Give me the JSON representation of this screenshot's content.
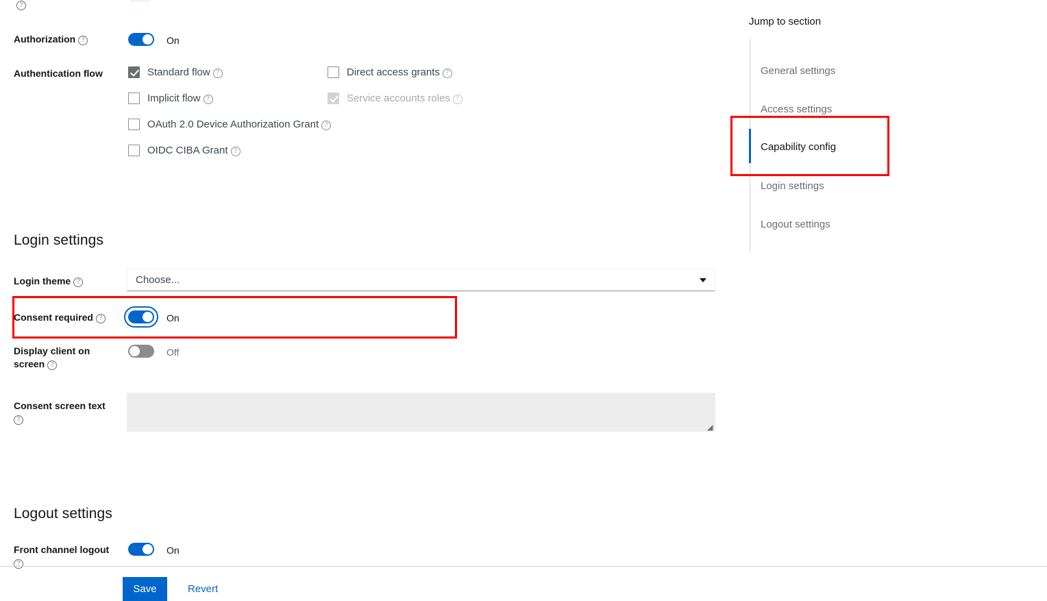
{
  "capability_config": {
    "authorization": {
      "label": "Authorization",
      "help": "?",
      "state": "On",
      "enabled": true
    },
    "authentication_flow": {
      "label": "Authentication flow",
      "options": [
        {
          "label": "Standard flow",
          "checked": true,
          "disabled": false,
          "help": "?"
        },
        {
          "label": "Direct access grants",
          "checked": false,
          "disabled": false,
          "help": "?"
        },
        {
          "label": "Implicit flow",
          "checked": false,
          "disabled": false,
          "help": "?"
        },
        {
          "label": "Service accounts roles",
          "checked": true,
          "disabled": true,
          "help": "?"
        },
        {
          "label": "OAuth 2.0 Device Authorization Grant",
          "checked": false,
          "disabled": false,
          "help": "?"
        },
        {
          "label": "OIDC CIBA Grant",
          "checked": false,
          "disabled": false,
          "help": "?"
        }
      ]
    }
  },
  "login_settings": {
    "heading": "Login settings",
    "login_theme": {
      "label": "Login theme",
      "help": "?",
      "value": "Choose...",
      "caret": "chevron-down-icon"
    },
    "consent_required": {
      "label": "Consent required",
      "help": "?",
      "state": "On",
      "enabled": true,
      "focused": true,
      "highlighted": true
    },
    "display_client_on_screen": {
      "label_line1": "Display client on",
      "label_line2": "screen",
      "help": "?",
      "state": "Off",
      "enabled": false
    },
    "consent_screen_text": {
      "label": "Consent screen text",
      "help": "?",
      "value": "",
      "disabled": true
    }
  },
  "logout_settings": {
    "heading": "Logout settings",
    "front_channel_logout": {
      "label": "Front channel logout",
      "help": "?",
      "state": "On",
      "enabled": true
    }
  },
  "jump_to_section": {
    "title": "Jump to section",
    "items": [
      {
        "label": "General settings",
        "active": false
      },
      {
        "label": "Access settings",
        "active": false
      },
      {
        "label": "Capability config",
        "active": true,
        "highlighted": true
      },
      {
        "label": "Login settings",
        "active": false
      },
      {
        "label": "Logout settings",
        "active": false
      }
    ]
  },
  "footer": {
    "save_label": "Save",
    "revert_label": "Revert"
  },
  "colors": {
    "accent_blue": "#0066cc",
    "toggle_off_gray": "#8a8d90",
    "annotation_red": "#ff0000",
    "text_primary": "#151515",
    "text_muted": "#6a6e73",
    "textarea_bg": "#ededed"
  }
}
